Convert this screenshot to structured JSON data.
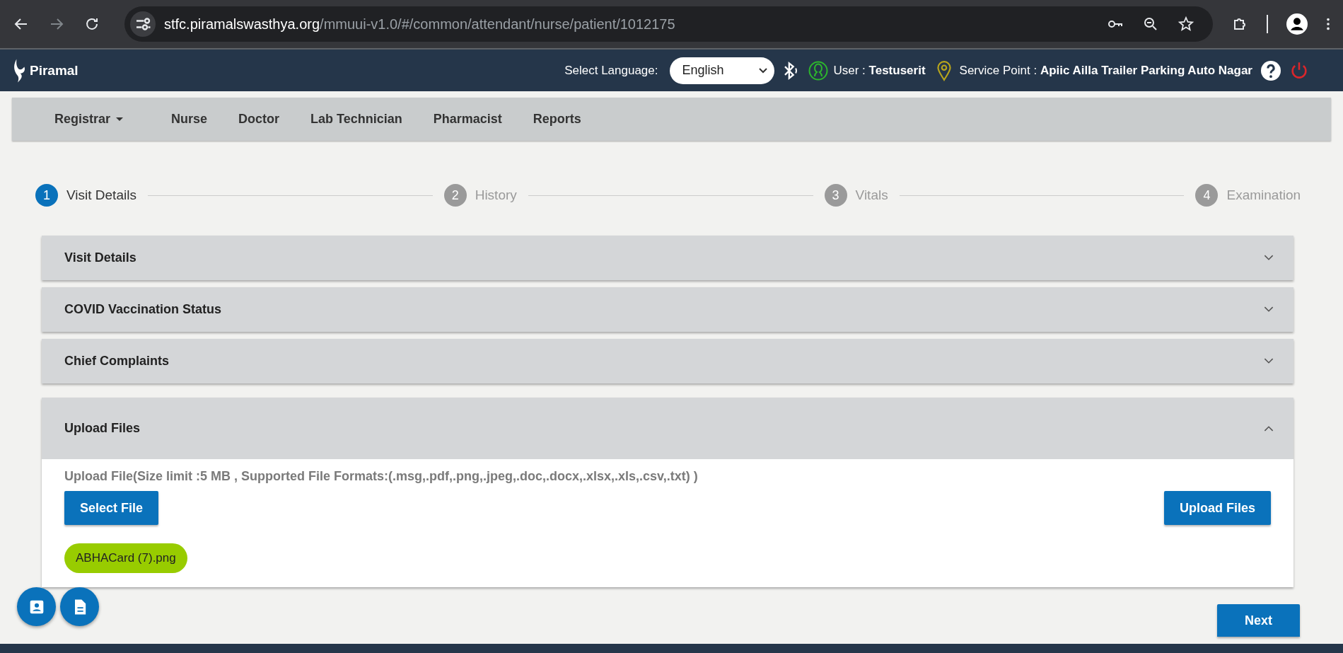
{
  "browser": {
    "url_host": "stfc.piramalswasthya.org",
    "url_path": "/mmuui-v1.0/#/common/attendant/nurse/patient/1012175"
  },
  "header": {
    "logo": "Piramal",
    "language_label": "Select Language:",
    "language": "English",
    "user_label": "User :",
    "user": "Testuserit",
    "service_point_label": "Service Point :",
    "service_point": "Apiic Ailla Trailer Parking Auto Nagar"
  },
  "nav": [
    {
      "label": "Registrar",
      "dropdown": true
    },
    {
      "label": "Nurse",
      "dropdown": false
    },
    {
      "label": "Doctor",
      "dropdown": false
    },
    {
      "label": "Lab Technician",
      "dropdown": false
    },
    {
      "label": "Pharmacist",
      "dropdown": false
    },
    {
      "label": "Reports",
      "dropdown": false
    }
  ],
  "steps": [
    {
      "number": "1",
      "label": "Visit Details",
      "selected": true
    },
    {
      "number": "2",
      "label": "History",
      "selected": false
    },
    {
      "number": "3",
      "label": "Vitals",
      "selected": false
    },
    {
      "number": "4",
      "label": "Examination",
      "selected": false
    }
  ],
  "panels": [
    {
      "title": "Visit Details",
      "expanded": false
    },
    {
      "title": "COVID Vaccination Status",
      "expanded": false
    },
    {
      "title": "Chief Complaints",
      "expanded": false
    },
    {
      "title": "Upload Files",
      "expanded": true
    }
  ],
  "upload": {
    "hint": "Upload File(Size limit :5 MB , Supported File Formats:(.msg,.pdf,.png,.jpeg,.doc,.docx,.xlsx,.xls,.csv,.txt) )",
    "select_button": "Select File",
    "upload_button": "Upload Files",
    "files": [
      "ABHACard (7).png"
    ]
  },
  "next_button": "Next"
}
